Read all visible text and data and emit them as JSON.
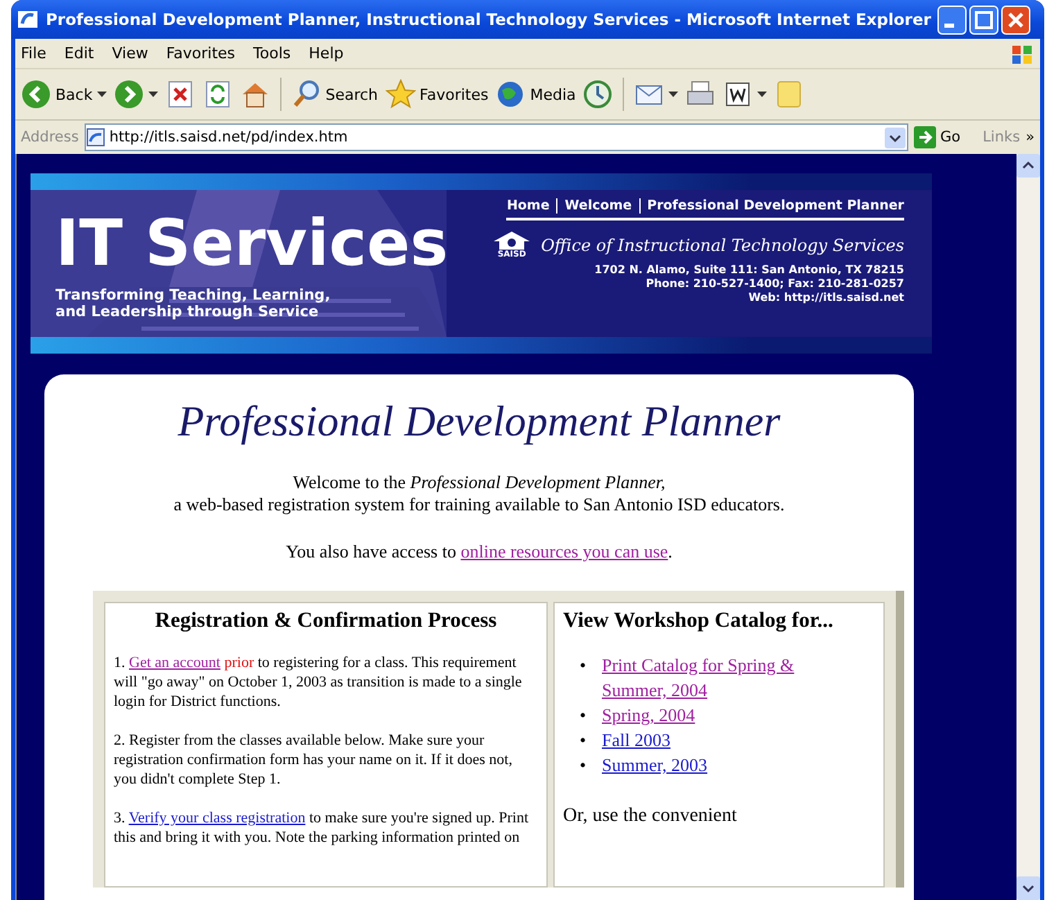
{
  "window": {
    "title": "Professional Development Planner, Instructional Technology Services - Microsoft Internet Explorer"
  },
  "menu": [
    "File",
    "Edit",
    "View",
    "Favorites",
    "Tools",
    "Help"
  ],
  "toolbar": [
    {
      "kind": "back",
      "label": "Back"
    },
    {
      "kind": "forward"
    },
    {
      "kind": "stop"
    },
    {
      "kind": "refresh"
    },
    {
      "kind": "home"
    },
    {
      "kind": "search",
      "label": "Search"
    },
    {
      "kind": "favorites",
      "label": "Favorites"
    },
    {
      "kind": "media",
      "label": "Media"
    },
    {
      "kind": "history"
    },
    {
      "kind": "mail"
    },
    {
      "kind": "print"
    },
    {
      "kind": "word"
    },
    {
      "kind": "note"
    }
  ],
  "address_bar": {
    "label": "Address",
    "value": "http://itls.saisd.net/pd/index.htm",
    "go": "Go",
    "links": "Links",
    "more": "»"
  },
  "banner": {
    "title": "IT Services",
    "tagline": [
      "Transforming Teaching, Learning,",
      "and Leadership through Service"
    ],
    "nav": [
      "Home",
      "Welcome",
      "Professional Development Planner"
    ],
    "office": "Office of Instructional Technology Services",
    "logo_text": "SAISD",
    "address_lines": [
      "1702 N. Alamo, Suite 111: San Antonio, TX 78215",
      "Phone: 210-527-1400; Fax: 210-281-0257",
      "Web: http://itls.saisd.net"
    ]
  },
  "page": {
    "heading": "Professional Development Planner",
    "intro": [
      {
        "kind": "text",
        "text": "Welcome to the "
      },
      {
        "kind": "italic",
        "text": "Professional Development Planner,"
      },
      {
        "kind": "break"
      },
      {
        "kind": "text",
        "text": "a web-based registration system for training available to San Antonio ISD educators."
      }
    ],
    "access": [
      {
        "kind": "text",
        "text": "You also have access to "
      },
      {
        "kind": "link",
        "text": "online resources you can use",
        "visited": true
      },
      {
        "kind": "text",
        "text": "."
      }
    ],
    "process": {
      "heading": "Registration & Confirmation Process",
      "paragraphs": [
        [
          {
            "kind": "text",
            "text": "1. "
          },
          {
            "kind": "link",
            "text": "Get an account",
            "visited": true
          },
          {
            "kind": "alert",
            "text": " prior"
          },
          {
            "kind": "text",
            "text": " to registering for a class. This requirement will \"go away\" on October 1, 2003 as transition is made to a single login for District functions."
          }
        ],
        [
          {
            "kind": "text",
            "text": "2. Register from the classes available below. Make sure your registration confirmation form has your name on it. If it does not, you didn't complete Step 1."
          }
        ],
        [
          {
            "kind": "text",
            "text": "3. "
          },
          {
            "kind": "link",
            "text": "Verify your class registration",
            "visited": false
          },
          {
            "kind": "text",
            "text": " to make sure you're signed up. Print this and bring it with you. Note the parking information printed on"
          }
        ]
      ]
    },
    "catalog": {
      "heading": "View Workshop Catalog for...",
      "items": [
        {
          "marker": "•",
          "text": "Print Catalog for Spring & Summer, 2004",
          "visited": true
        },
        {
          "marker": "•",
          "text": "Spring, 2004",
          "visited": true
        },
        {
          "marker": "•",
          "text": "Fall 2003",
          "visited": false
        },
        {
          "marker": "•",
          "text": "Summer, 2003",
          "visited": false
        }
      ],
      "footer": "Or, use the convenient"
    }
  }
}
